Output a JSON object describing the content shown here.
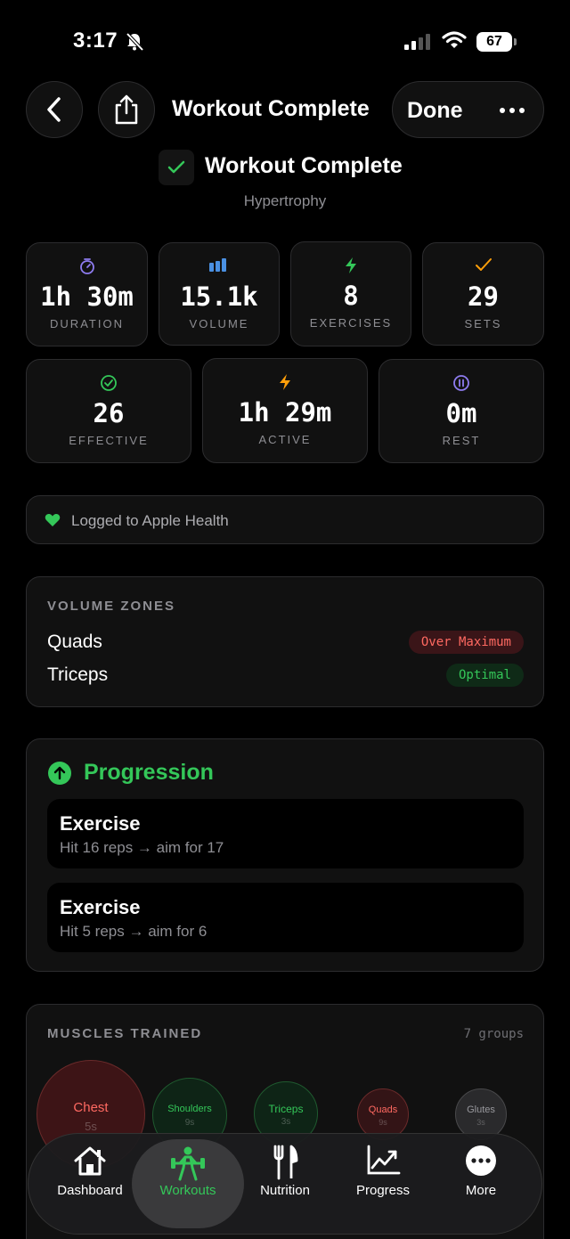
{
  "status_bar": {
    "time": "3:17",
    "battery": "67"
  },
  "nav": {
    "title": "Workout Complete",
    "done_label": "Done"
  },
  "header": {
    "title": "Workout Complete",
    "subtitle": "Hypertrophy"
  },
  "stats_row1": [
    {
      "value": "1h 30m",
      "label": "DURATION",
      "icon": "timer-icon",
      "color": "#8e7cf0"
    },
    {
      "value": "15.1k",
      "label": "VOLUME",
      "icon": "bar-chart-icon",
      "color": "#4a90e2"
    },
    {
      "value": "8",
      "label": "EXERCISES",
      "icon": "bolt-icon",
      "color": "#34c759"
    },
    {
      "value": "29",
      "label": "SETS",
      "icon": "check-icon",
      "color": "#ff9f0a"
    }
  ],
  "stats_row2": [
    {
      "value": "26",
      "label": "EFFECTIVE",
      "icon": "check-circle-icon",
      "color": "#34c759"
    },
    {
      "value": "1h 29m",
      "label": "ACTIVE",
      "icon": "bolt-icon",
      "color": "#ff9f0a"
    },
    {
      "value": "0m",
      "label": "REST",
      "icon": "pause-circle-icon",
      "color": "#8e7cf0"
    }
  ],
  "health": {
    "text": "Logged to Apple Health"
  },
  "volume_zones": {
    "title": "VOLUME ZONES",
    "rows": [
      {
        "muscle": "Quads",
        "status": "Over Maximum",
        "color": "#ff6961"
      },
      {
        "muscle": "Triceps",
        "status": "Optimal",
        "color": "#34c759"
      }
    ]
  },
  "progression": {
    "title": "Progression",
    "items": [
      {
        "name": "Exercise",
        "detail": "Hit 16 reps → aim for 17"
      },
      {
        "name": "Exercise",
        "detail": "Hit 5 reps → aim for 6"
      }
    ]
  },
  "muscles": {
    "title": "MUSCLES TRAINED",
    "count": "7 groups",
    "bubbles": [
      {
        "name": "Chest",
        "value": "5s"
      },
      {
        "name": "Shoulders",
        "value": "9s"
      },
      {
        "name": "Triceps",
        "value": "3s"
      },
      {
        "name": "Quads",
        "value": "9s"
      },
      {
        "name": "Glutes",
        "value": "3s"
      }
    ]
  },
  "tabs": [
    {
      "label": "Dashboard",
      "icon": "house-icon"
    },
    {
      "label": "Workouts",
      "icon": "weightlifter-icon",
      "active": true
    },
    {
      "label": "Nutrition",
      "icon": "fork-knife-icon"
    },
    {
      "label": "Progress",
      "icon": "chart-icon"
    },
    {
      "label": "More",
      "icon": "more-icon"
    }
  ]
}
